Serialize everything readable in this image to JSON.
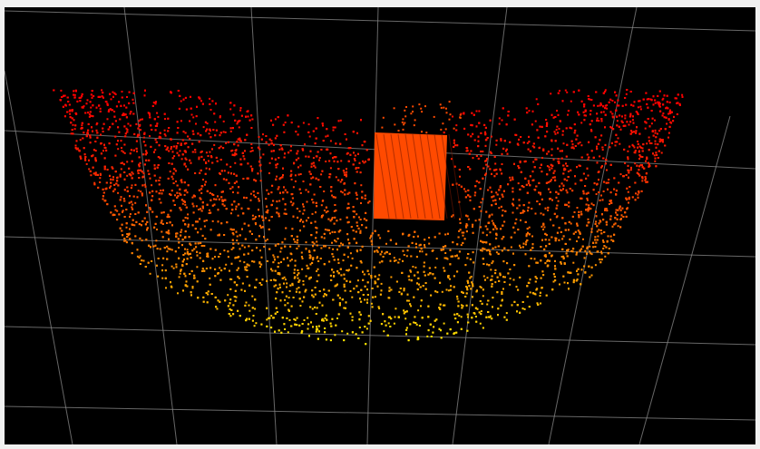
{
  "viewer": {
    "background_color": "#000000",
    "frame_color": "#f0f0f0",
    "grid_color": "#8a8a8a",
    "colormap": [
      "#ffff00",
      "#ffb000",
      "#ff6a00",
      "#ff2000",
      "#ff0000"
    ],
    "object_color": "#ff4a00",
    "object_stripe_color": "#7a1800"
  }
}
